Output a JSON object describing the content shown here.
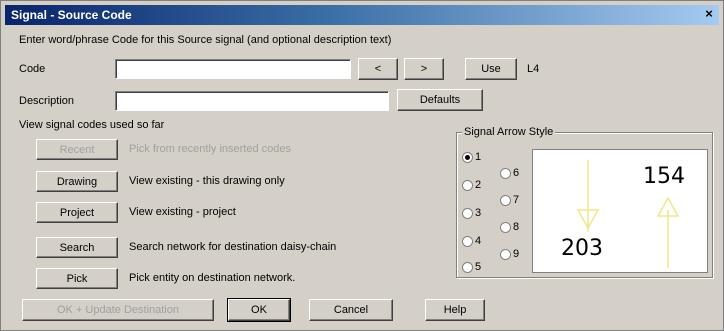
{
  "window": {
    "title": "Signal - Source Code",
    "close_glyph": "×"
  },
  "instructions": "Enter word/phrase Code for this Source signal (and optional description text)",
  "code": {
    "label": "Code",
    "value": "",
    "prev_label": "<",
    "next_label": ">",
    "use_label": "Use",
    "use_value": "L4"
  },
  "description": {
    "label": "Description",
    "value": "",
    "defaults_label": "Defaults"
  },
  "view_section": {
    "label": "View signal codes used so far",
    "rows": [
      {
        "button": "Recent",
        "text": "Pick from recently inserted codes",
        "disabled": true
      },
      {
        "button": "Drawing",
        "text": "View existing - this drawing only",
        "disabled": false
      },
      {
        "button": "Project",
        "text": "View existing - project",
        "disabled": false
      },
      {
        "button": "Search",
        "text": "Search network for destination daisy-chain",
        "disabled": false
      },
      {
        "button": "Pick",
        "text": "Pick entity on destination network.",
        "disabled": false
      }
    ]
  },
  "arrow_style": {
    "label": "Signal Arrow Style",
    "options": [
      "1",
      "2",
      "3",
      "4",
      "5",
      "6",
      "7",
      "8",
      "9"
    ],
    "selected": "1",
    "preview": {
      "down_number": "203",
      "up_number": "154",
      "arrow_color": "#f0e68c"
    }
  },
  "footer": {
    "ok_update_label": "OK + Update Destination",
    "ok_label": "OK",
    "cancel_label": "Cancel",
    "help_label": "Help"
  }
}
